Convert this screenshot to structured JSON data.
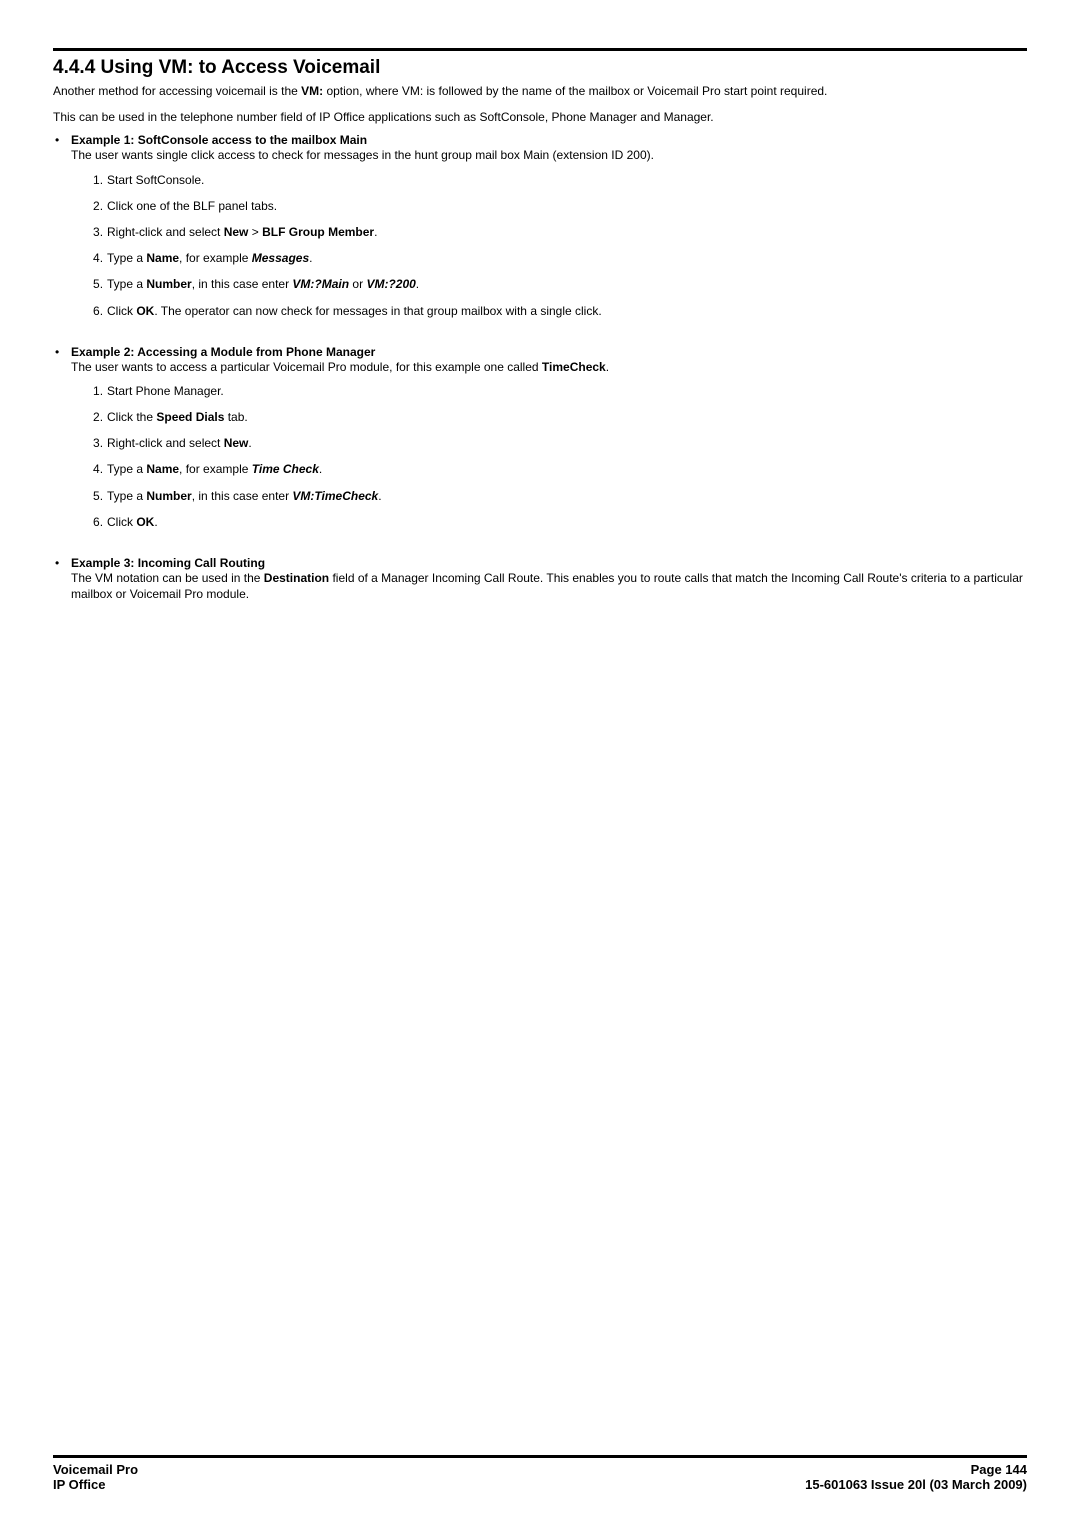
{
  "heading": "4.4.4 Using VM: to Access Voicemail",
  "intro1_pre": "Another method for accessing voicemail is the ",
  "intro1_bold": "VM:",
  "intro1_post": " option, where VM: is followed by the name of the mailbox or Voicemail Pro start point required.",
  "intro2": "This can be used in the telephone number field of IP Office applications such as SoftConsole, Phone Manager and Manager.",
  "ex1": {
    "title": "Example 1: SoftConsole access to the mailbox Main",
    "desc": "The user wants single click access to check for messages in the hunt group mail box Main (extension ID 200).",
    "s1": "Start SoftConsole.",
    "s2": "Click one of the BLF panel tabs.",
    "s3a": "Right-click and select ",
    "s3b": "New",
    "s3c": " > ",
    "s3d": "BLF Group Member",
    "s3e": ".",
    "s4a": "Type a ",
    "s4b": "Name",
    "s4c": ", for example ",
    "s4d": "Messages",
    "s4e": ".",
    "s5a": "Type a ",
    "s5b": "Number",
    "s5c": ", in this case enter ",
    "s5d": "VM:?Main",
    "s5e": " or ",
    "s5f": "VM:?200",
    "s5g": ".",
    "s6a": "Click ",
    "s6b": "OK",
    "s6c": ". The operator can now check for messages in that group mailbox with a single click."
  },
  "ex2": {
    "title": "Example 2: Accessing a Module from Phone Manager",
    "desc_pre": "The user wants to access a particular Voicemail Pro module, for this example one called ",
    "desc_bold": "TimeCheck",
    "desc_post": ".",
    "s1": "Start Phone Manager.",
    "s2a": "Click the ",
    "s2b": "Speed Dials",
    "s2c": " tab.",
    "s3a": "Right-click and select ",
    "s3b": "New",
    "s3c": ".",
    "s4a": "Type a ",
    "s4b": "Name",
    "s4c": ", for example ",
    "s4d": "Time Check",
    "s4e": ".",
    "s5a": "Type a ",
    "s5b": "Number",
    "s5c": ", in this case enter ",
    "s5d": "VM:TimeCheck",
    "s5e": ".",
    "s6a": "Click ",
    "s6b": "OK",
    "s6c": "."
  },
  "ex3": {
    "title": "Example 3: Incoming Call Routing",
    "desc_pre": "The VM notation can be used in the ",
    "desc_bold": "Destination",
    "desc_post": " field of a Manager Incoming Call Route. This enables you to route calls that match the Incoming Call Route's criteria to a particular mailbox or Voicemail Pro module."
  },
  "footer": {
    "l1": "Voicemail Pro",
    "l2": "IP Office",
    "r1": "Page 144",
    "r2": "15-601063 Issue 20l (03 March 2009)"
  }
}
